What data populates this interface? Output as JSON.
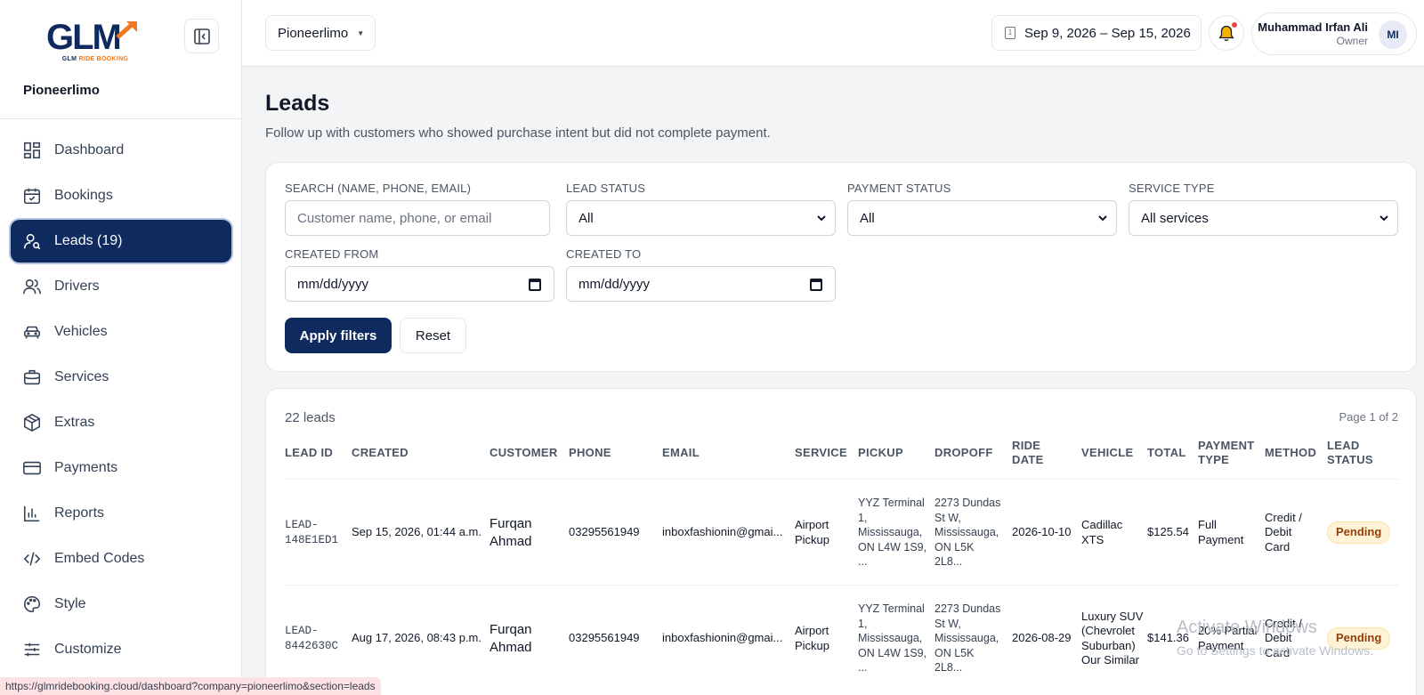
{
  "sidebar": {
    "logo_text": "GLM",
    "logo_sub_a": "GLM",
    "logo_sub_b": "RIDE BOOKING",
    "company": "Pioneerlimo",
    "items": [
      {
        "label": "Dashboard",
        "icon": "dashboard-icon"
      },
      {
        "label": "Bookings",
        "icon": "calendar-check-icon"
      },
      {
        "label": "Leads (19)",
        "icon": "user-search-icon",
        "active": true
      },
      {
        "label": "Drivers",
        "icon": "users-icon"
      },
      {
        "label": "Vehicles",
        "icon": "car-icon"
      },
      {
        "label": "Services",
        "icon": "briefcase-icon"
      },
      {
        "label": "Extras",
        "icon": "package-icon"
      },
      {
        "label": "Payments",
        "icon": "credit-card-icon"
      },
      {
        "label": "Reports",
        "icon": "bar-chart-icon"
      },
      {
        "label": "Embed Codes",
        "icon": "code-icon"
      },
      {
        "label": "Style",
        "icon": "palette-icon"
      },
      {
        "label": "Customize",
        "icon": "sliders-icon"
      }
    ]
  },
  "topbar": {
    "company_select": "Pioneerlimo",
    "date_range": "Sep 9, 2026 – Sep 15, 2026",
    "calendar_glyph": "1",
    "user_name": "Muhammad Irfan Ali",
    "user_role": "Owner",
    "avatar_initials": "MI"
  },
  "page": {
    "title": "Leads",
    "subtitle": "Follow up with customers who showed purchase intent but did not complete payment."
  },
  "filters": {
    "search_label": "SEARCH (NAME, PHONE, EMAIL)",
    "search_placeholder": "Customer name, phone, or email",
    "lead_status_label": "LEAD STATUS",
    "lead_status_value": "All",
    "payment_status_label": "PAYMENT STATUS",
    "payment_status_value": "All",
    "service_type_label": "SERVICE TYPE",
    "service_type_value": "All services",
    "created_from_label": "CREATED FROM",
    "created_from_value": "mm/dd/yyyy",
    "created_to_label": "CREATED TO",
    "created_to_value": "mm/dd/yyyy",
    "apply_label": "Apply filters",
    "reset_label": "Reset"
  },
  "table": {
    "count": "22 leads",
    "page_info": "Page 1 of 2",
    "headers": [
      "LEAD ID",
      "CREATED",
      "CUSTOMER",
      "PHONE",
      "EMAIL",
      "SERVICE",
      "PICKUP",
      "DROPOFF",
      "RIDE DATE",
      "VEHICLE",
      "TOTAL",
      "PAYMENT TYPE",
      "METHOD",
      "LEAD STATUS"
    ],
    "rows": [
      {
        "lead_id": "LEAD-148E1ED1",
        "created": "Sep 15, 2026, 01:44 a.m.",
        "customer": "Furqan Ahmad",
        "phone": "03295561949",
        "email": "inboxfashionin@gmai...",
        "service": "Airport Pickup",
        "pickup": "YYZ Terminal 1, Mississauga, ON L4W 1S9, ...",
        "dropoff": "2273 Dundas St W, Mississauga, ON L5K 2L8...",
        "ride_date": "2026-10-10",
        "vehicle": "Cadillac XTS",
        "total": "$125.54",
        "payment_type": "Full Payment",
        "method": "Credit / Debit Card",
        "status": "Pending"
      },
      {
        "lead_id": "LEAD-8442630C",
        "created": "Aug 17, 2026, 08:43 p.m.",
        "customer": "Furqan Ahmad",
        "phone": "03295561949",
        "email": "inboxfashionin@gmai...",
        "service": "Airport Pickup",
        "pickup": "YYZ Terminal 1, Mississauga, ON L4W 1S9, ...",
        "dropoff": "2273 Dundas St W, Mississauga, ON L5K 2L8...",
        "ride_date": "2026-08-29",
        "vehicle": "Luxury SUV (Chevrolet Suburban) Our Similar",
        "total": "$141.36",
        "payment_type": "20% Partial Payment",
        "method": "Credit / Debit Card",
        "status": "Pending"
      }
    ]
  },
  "status_bar_url": "https://glmridebooking.cloud/dashboard?company=pioneerlimo&section=leads",
  "watermark": {
    "title": "Activate Windows",
    "subtitle": "Go to Settings to activate Windows."
  },
  "colors": {
    "primary": "#0f2a5e",
    "accent": "#f07a1f",
    "badge_bg": "#fff3d6",
    "badge_text": "#92400e"
  }
}
